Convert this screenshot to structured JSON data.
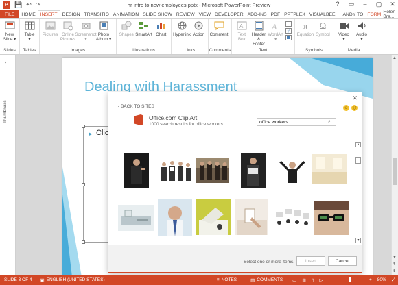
{
  "window": {
    "title": "hr intro to new employees.pptx - Microsoft PowerPoint Preview",
    "app_icon": "P",
    "controls": [
      "?",
      "▭",
      "–",
      "▢",
      "✕"
    ]
  },
  "qat": {
    "save": "💾",
    "undo": "↶",
    "redo": "↷"
  },
  "tabs": [
    {
      "label": "FILE"
    },
    {
      "label": "HOME"
    },
    {
      "label": "INSERT"
    },
    {
      "label": "DESIGN"
    },
    {
      "label": "TRANSITIO"
    },
    {
      "label": "ANIMATION"
    },
    {
      "label": "SLIDE SHOW"
    },
    {
      "label": "REVIEW"
    },
    {
      "label": "VIEW"
    },
    {
      "label": "DEVELOPER"
    },
    {
      "label": "ADD-INS"
    },
    {
      "label": "PDF"
    },
    {
      "label": "PPTPLEX"
    },
    {
      "label": "VISUALBEE"
    },
    {
      "label": "HANDY TO"
    },
    {
      "label": "FORM"
    }
  ],
  "user": "Helen Bra...",
  "ribbon": {
    "groups": [
      {
        "label": "Slides",
        "items": [
          {
            "label": "New\nSlide ▾"
          }
        ]
      },
      {
        "label": "Tables",
        "items": [
          {
            "label": "Table\n▾"
          }
        ]
      },
      {
        "label": "Images",
        "items": [
          {
            "label": "Pictures"
          },
          {
            "label": "Online\nPictures"
          },
          {
            "label": "Screenshot\n▾"
          },
          {
            "label": "Photo\nAlbum ▾"
          }
        ]
      },
      {
        "label": "Illustrations",
        "items": [
          {
            "label": "Shapes"
          },
          {
            "label": "SmartArt"
          },
          {
            "label": "Chart"
          }
        ]
      },
      {
        "label": "Links",
        "items": [
          {
            "label": "Hyperlink"
          },
          {
            "label": "Action"
          }
        ]
      },
      {
        "label": "Comments",
        "items": [
          {
            "label": "Comment"
          }
        ]
      },
      {
        "label": "Text",
        "items": [
          {
            "label": "Text\nBox"
          },
          {
            "label": "Header\n& Footer"
          },
          {
            "label": "WordArt\n▾"
          }
        ]
      },
      {
        "label": "Symbols",
        "items": [
          {
            "label": "Equation"
          },
          {
            "label": "Symbol"
          }
        ]
      },
      {
        "label": "Media",
        "items": [
          {
            "label": "Video\n▾"
          },
          {
            "label": "Audio\n▾"
          }
        ]
      }
    ]
  },
  "thumbnails": {
    "label": "Thumbnails"
  },
  "slide": {
    "title": "Dealing with Harassment",
    "placeholder": "Clic"
  },
  "dialog": {
    "back": "‹ BACK TO SITES",
    "provider_name": "Office.com Clip Art",
    "result_count": "1000 search results for office workers",
    "search_value": "office workers",
    "footer_message": "Select one or more items.",
    "insert_label": "Insert",
    "cancel_label": "Cancel",
    "close": "✕"
  },
  "status": {
    "slide": "SLIDE 3 OF 4",
    "language": "ENGLISH (UNITED STATES)",
    "notes": "NOTES",
    "comments": "COMMENTS",
    "zoom": "80%"
  },
  "colors": {
    "accent": "#d24726",
    "title_blue": "#5fb5d9"
  }
}
